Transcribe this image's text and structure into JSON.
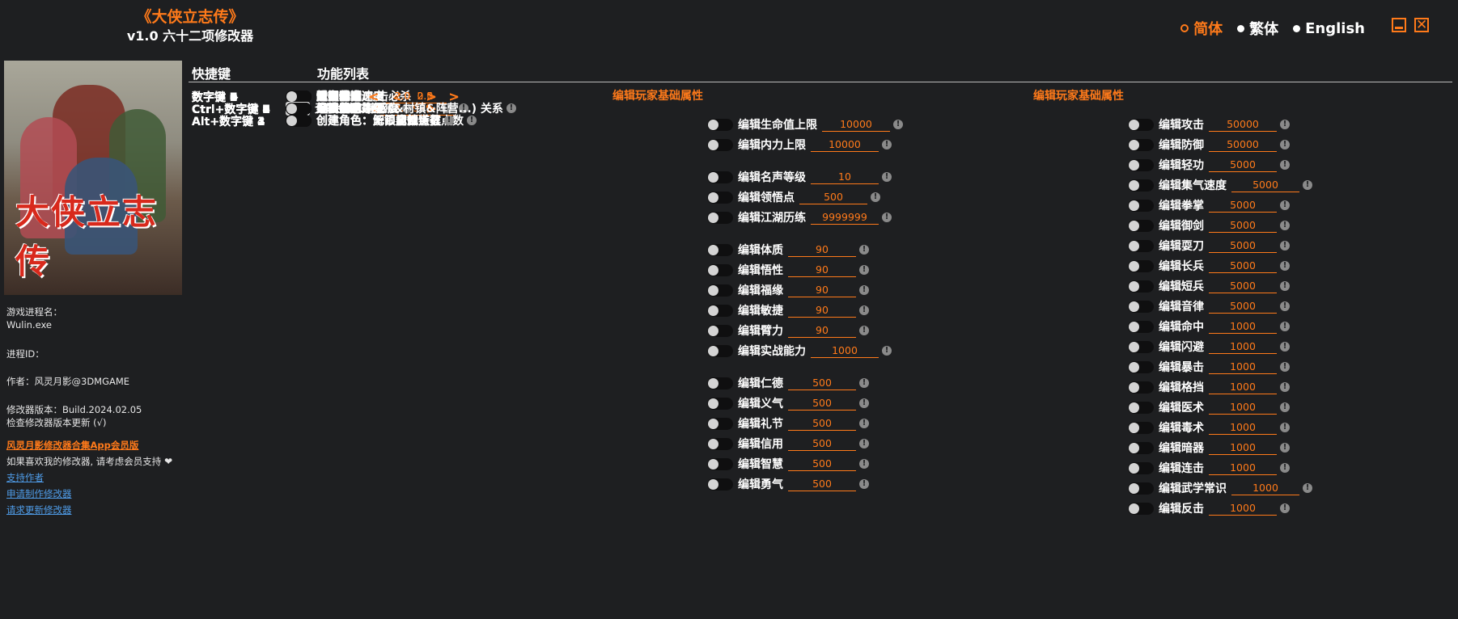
{
  "app": {
    "title": "《大侠立志传》",
    "subtitle": "v1.0 六十二项修改器"
  },
  "languages": [
    "简体",
    "繁体",
    "English"
  ],
  "active_language": "简体",
  "cover_logo": "大侠立志传",
  "sidebar": {
    "process_name_label": "游戏进程名：",
    "process_name": "Wulin.exe",
    "process_id_label": "进程ID：",
    "author": "作者：风灵月影@3DMGAME",
    "version": "修改器版本：Build.2024.02.05",
    "check_update": "检查修改器版本更新 (√)",
    "vip_link": "风灵月影修改器合集App会员版",
    "support_text": "如果喜欢我的修改器, 请考虑会员支持",
    "links": [
      "支持作者",
      "申请制作修改器",
      "请求更新修改器"
    ]
  },
  "headers": {
    "hotkeys": "快捷键",
    "features": "功能列表"
  },
  "section_titles": [
    "编辑玩家基础属性",
    "编辑玩家基础属性"
  ],
  "apply_label": "应用",
  "features": [
    {
      "key": "数字键 1",
      "label": "无限生命",
      "info": true
    },
    {
      "key": "数字键 2",
      "label": "无限内力",
      "info": true
    },
    {
      "key": "数字键 3",
      "label": "瞬间行动",
      "info": true
    },
    {
      "key": "数字键 4",
      "label": "最高体力",
      "info": true
    },
    {
      "key": "数字键 5",
      "label": "最高心情",
      "info": true
    },
    {
      "key": "数字键 6",
      "label": "锁定时间",
      "info": false
    },
    {
      "key": "数字键 7",
      "label": "时间流逝速度",
      "value": "0.1",
      "arrows": true,
      "info": false
    },
    {
      "key": "数字键 8",
      "label": "设置移动速度",
      "value": "2.0",
      "arrows": true,
      "info": false
    },
    {
      "key": "数字键 9",
      "label": "设置游戏速度",
      "value": "2.5",
      "arrows": true,
      "info": false
    },
    {
      "key": "数字键 0",
      "label": "超级伤害/一击必杀",
      "info": false
    },
    {
      "key": "数字键 .",
      "label": "伤害倍率",
      "value": "2.0",
      "arrows": true,
      "info": false
    },
    {
      "key": "数字键 +",
      "label": "防御倍率",
      "value": "2.0",
      "arrows": true,
      "info": false
    },
    {
      "key": "Ctrl+数字键 1",
      "label": "无限金钱",
      "apply": true,
      "info": true
    },
    {
      "key": "Ctrl+数字键 2",
      "label": "金钱倍率",
      "value": "2.0",
      "arrows": true,
      "info": true
    },
    {
      "key": "Ctrl+数字键 3",
      "label": "编辑物品数量",
      "value": "999",
      "info": true
    },
    {
      "key": "Ctrl+数字键 4",
      "label": "无限经验",
      "info": true
    },
    {
      "key": "Ctrl+数字键 5",
      "label": "经验倍率",
      "value": "2.0",
      "arrows": true,
      "info": true
    },
    {
      "key": "Ctrl+数字键 6",
      "label": "最高武功等级",
      "info": true
    },
    {
      "key": "Ctrl+数字键 7",
      "label": "最高能力等级",
      "info": true
    },
    {
      "key": "Ctrl+数字键 8",
      "label": "最高NPC好感度",
      "info": true
    },
    {
      "key": "Ctrl+数字键 9",
      "label": "最高派系 (门派&村镇&阵营...) 关系",
      "info": true
    },
    {
      "key": "Alt+数字键 1",
      "label": "创建角色：无限属性点数",
      "info": true
    },
    {
      "key": "Alt+数字键 2",
      "label": "创建角色：无限成就点数",
      "info": true
    },
    {
      "key": "Alt+数字键 3",
      "label": "创建角色：无限初始道具点数",
      "info": true
    },
    {
      "key": "Alt+数字键 4",
      "label": "创建角色：解锁全部特征",
      "info": true
    }
  ],
  "attributes_col2": [
    {
      "label": "编辑生命值上限",
      "value": "10000"
    },
    {
      "label": "编辑内力上限",
      "value": "10000"
    },
    {
      "label": "编辑名声等级",
      "value": "10"
    },
    {
      "label": "编辑领悟点",
      "value": "500"
    },
    {
      "label": "编辑江湖历练",
      "value": "9999999"
    },
    {
      "label": "编辑体质",
      "value": "90"
    },
    {
      "label": "编辑悟性",
      "value": "90"
    },
    {
      "label": "编辑福缘",
      "value": "90"
    },
    {
      "label": "编辑敏捷",
      "value": "90"
    },
    {
      "label": "编辑臂力",
      "value": "90"
    },
    {
      "label": "编辑实战能力",
      "value": "1000"
    },
    {
      "label": "编辑仁德",
      "value": "500"
    },
    {
      "label": "编辑义气",
      "value": "500"
    },
    {
      "label": "编辑礼节",
      "value": "500"
    },
    {
      "label": "编辑信用",
      "value": "500"
    },
    {
      "label": "编辑智慧",
      "value": "500"
    },
    {
      "label": "编辑勇气",
      "value": "500"
    }
  ],
  "attributes_col3": [
    {
      "label": "编辑攻击",
      "value": "50000"
    },
    {
      "label": "编辑防御",
      "value": "50000"
    },
    {
      "label": "编辑轻功",
      "value": "5000"
    },
    {
      "label": "编辑集气速度",
      "value": "5000"
    },
    {
      "label": "编辑拳掌",
      "value": "5000"
    },
    {
      "label": "编辑御剑",
      "value": "5000"
    },
    {
      "label": "编辑耍刀",
      "value": "5000"
    },
    {
      "label": "编辑长兵",
      "value": "5000"
    },
    {
      "label": "编辑短兵",
      "value": "5000"
    },
    {
      "label": "编辑音律",
      "value": "5000"
    },
    {
      "label": "编辑命中",
      "value": "1000"
    },
    {
      "label": "编辑闪避",
      "value": "1000"
    },
    {
      "label": "编辑暴击",
      "value": "1000"
    },
    {
      "label": "编辑格挡",
      "value": "1000"
    },
    {
      "label": "编辑医术",
      "value": "1000"
    },
    {
      "label": "编辑毒术",
      "value": "1000"
    },
    {
      "label": "编辑暗器",
      "value": "1000"
    },
    {
      "label": "编辑连击",
      "value": "1000"
    },
    {
      "label": "编辑武学常识",
      "value": "1000"
    },
    {
      "label": "编辑反击",
      "value": "1000"
    }
  ],
  "colors": {
    "accent": "#ff7a1a",
    "background": "#1e1f21",
    "link": "#4f9ce8"
  }
}
